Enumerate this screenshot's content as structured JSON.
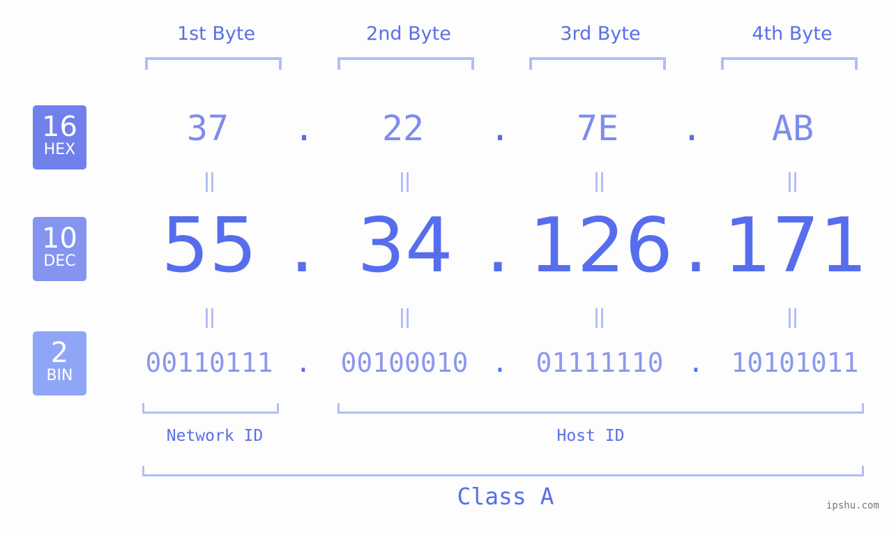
{
  "byte_headers": [
    "1st Byte",
    "2nd Byte",
    "3rd Byte",
    "4th Byte"
  ],
  "badges": {
    "hex": {
      "number": "16",
      "label": "HEX",
      "color": "#7081ec"
    },
    "dec": {
      "number": "10",
      "label": "DEC",
      "color": "#8494f0"
    },
    "bin": {
      "number": "2",
      "label": "BIN",
      "color": "#8fa6f7"
    }
  },
  "hex_values": [
    "37",
    "22",
    "7E",
    "AB"
  ],
  "dec_values": [
    "55",
    "34",
    "126",
    "171"
  ],
  "bin_values": [
    "00110111",
    "00100010",
    "01111110",
    "10101011"
  ],
  "separator": ".",
  "network_id_label": "Network ID",
  "host_id_label": "Host ID",
  "class_label": "Class A",
  "watermark": "ipshu.com"
}
